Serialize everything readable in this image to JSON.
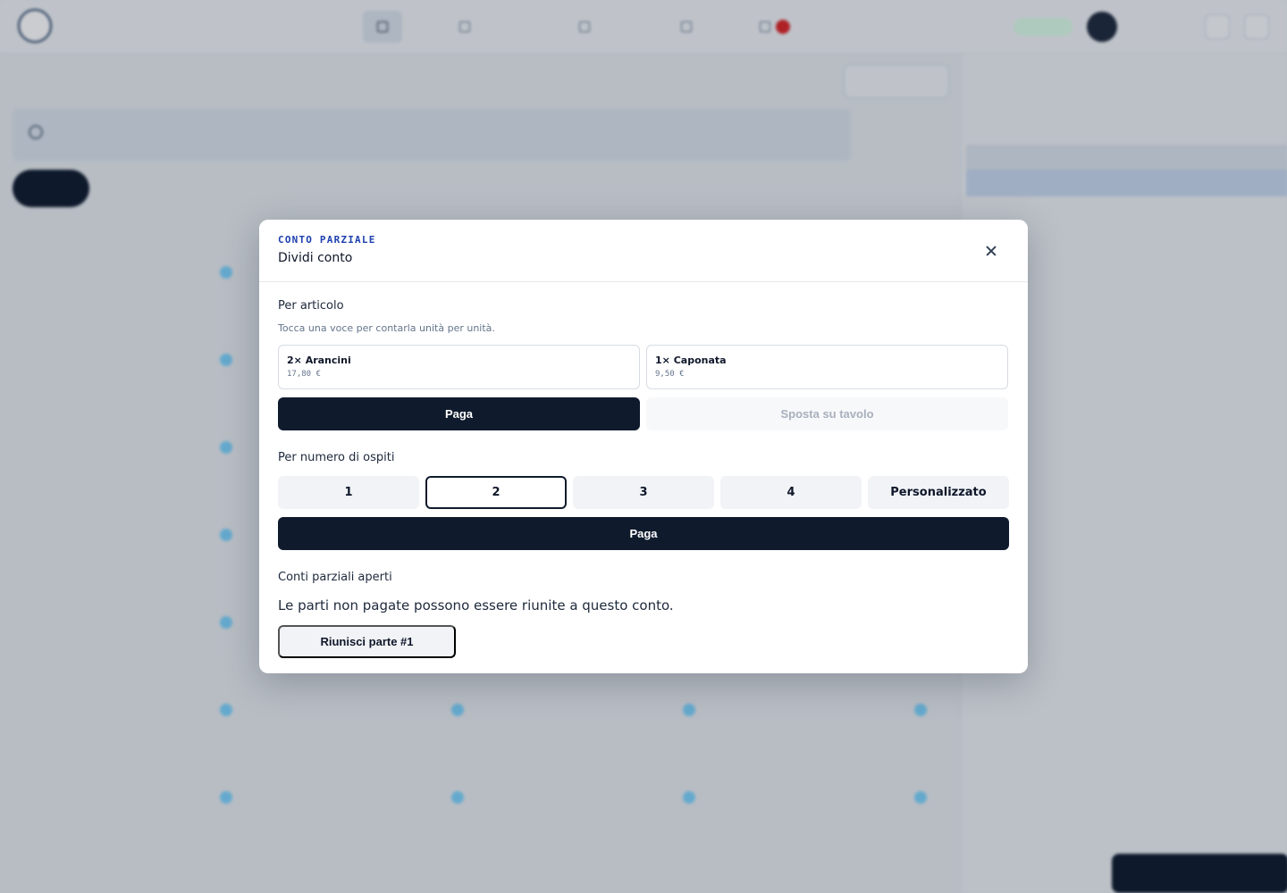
{
  "modal": {
    "eyebrow": "CONTO PARZIALE",
    "title": "Dividi conto",
    "by_item": {
      "label": "Per articolo",
      "hint": "Tocca una voce per contarla unità per unità.",
      "items": [
        {
          "name": "2× Arancini",
          "price": "17,80 €"
        },
        {
          "name": "1× Caponata",
          "price": "9,50 €"
        }
      ],
      "pay_label": "Paga",
      "move_label": "Sposta su tavolo"
    },
    "by_guests": {
      "label": "Per numero di ospiti",
      "options": [
        "1",
        "2",
        "3",
        "4",
        "Personalizzato"
      ],
      "selected": "2",
      "pay_label": "Paga"
    },
    "open_parts": {
      "label": "Conti parziali aperti",
      "text": "Le parti non pagate possono essere riunite a questo conto.",
      "merge_label": "Riunisci parte #1"
    }
  },
  "colors": {
    "primary": "#0f1b2d",
    "eyebrow": "#1e40af",
    "overlay": "rgba(15,23,42,0.22)"
  },
  "icons": {
    "close": "close-icon"
  }
}
